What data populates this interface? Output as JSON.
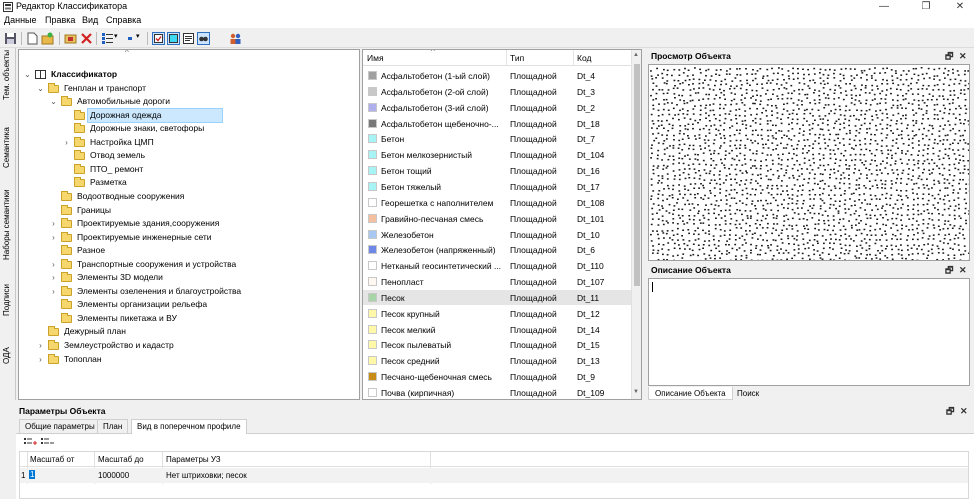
{
  "window": {
    "title": "Редактор Классификатора",
    "accent": "#0078d7"
  },
  "menu": [
    "Данные",
    "Правка",
    "Вид",
    "Справка"
  ],
  "toolbar": {
    "icons": [
      "save-icon",
      "new-icon",
      "new-group-icon",
      "open-folder-icon",
      "delete-icon",
      "list-view-icon",
      "dropdown-icon",
      "small-icon",
      "dropdown-icon",
      "checkbox-icon",
      "color-fill-icon",
      "text-view-icon",
      "find-icon",
      "users-icon"
    ]
  },
  "side_tabs": [
    "Тем. объекты",
    "Семантика",
    "Наборы семантики",
    "Подписи",
    "ОДА"
  ],
  "tree": [
    {
      "label": "Классификатор",
      "level": 0,
      "expand": "v",
      "icon": "book",
      "bold": true
    },
    {
      "label": "Генплан и транспорт",
      "level": 1,
      "expand": "v",
      "icon": "folder"
    },
    {
      "label": "Автомобильные дороги",
      "level": 2,
      "expand": "v",
      "icon": "folder"
    },
    {
      "label": "Дорожная одежда",
      "level": 3,
      "expand": "",
      "icon": "folder",
      "selected": true
    },
    {
      "label": "Дорожные знаки, светофоры",
      "level": 3,
      "expand": "",
      "icon": "folder"
    },
    {
      "label": "Настройка ЦМП",
      "level": 3,
      "expand": ">",
      "icon": "folder"
    },
    {
      "label": "Отвод земель",
      "level": 3,
      "expand": "",
      "icon": "folder"
    },
    {
      "label": "ПТО_ ремонт",
      "level": 3,
      "expand": "",
      "icon": "folder"
    },
    {
      "label": "Разметка",
      "level": 3,
      "expand": "",
      "icon": "folder"
    },
    {
      "label": "Водоотводные сооружения",
      "level": 2,
      "expand": "",
      "icon": "folder"
    },
    {
      "label": "Границы",
      "level": 2,
      "expand": "",
      "icon": "folder"
    },
    {
      "label": "Проектируемые здания,сооружения",
      "level": 2,
      "expand": ">",
      "icon": "folder"
    },
    {
      "label": "Проектируемые инженерные сети",
      "level": 2,
      "expand": ">",
      "icon": "folder"
    },
    {
      "label": "Разное",
      "level": 2,
      "expand": "",
      "icon": "folder"
    },
    {
      "label": "Транспортные сооружения  и устройства",
      "level": 2,
      "expand": ">",
      "icon": "folder"
    },
    {
      "label": "Элементы 3D модели",
      "level": 2,
      "expand": ">",
      "icon": "folder"
    },
    {
      "label": "Элементы озеленения и благоустройства",
      "level": 2,
      "expand": ">",
      "icon": "folder"
    },
    {
      "label": "Элементы организации рельефа",
      "level": 2,
      "expand": "",
      "icon": "folder"
    },
    {
      "label": "Элементы пикетажа и ВУ",
      "level": 2,
      "expand": "",
      "icon": "folder"
    },
    {
      "label": "Дежурный план",
      "level": 1,
      "expand": "",
      "icon": "folder"
    },
    {
      "label": "Землеустройство и кадастр",
      "level": 1,
      "expand": ">",
      "icon": "folder"
    },
    {
      "label": "Топоплан",
      "level": 1,
      "expand": ">",
      "icon": "folder"
    }
  ],
  "list": {
    "columns": [
      "Имя",
      "Тип",
      "Код"
    ],
    "rows": [
      {
        "name": "Асфальтобетон (1-ый слой)",
        "type": "Площадной",
        "code": "Dt_4",
        "color": "#a0a0a0"
      },
      {
        "name": "Асфальтобетон (2-ой слой)",
        "type": "Площадной",
        "code": "Dt_3",
        "color": "#c8c8c8"
      },
      {
        "name": "Асфальтобетон (3-ий слой)",
        "type": "Площадной",
        "code": "Dt_2",
        "color": "#b0b0ee"
      },
      {
        "name": "Асфальтобетон щебеночно-...",
        "type": "Площадной",
        "code": "Dt_18",
        "color": "#787878"
      },
      {
        "name": "Бетон",
        "type": "Площадной",
        "code": "Dt_7",
        "color": "#a8f4f4"
      },
      {
        "name": "Бетон мелкозернистый",
        "type": "Площадной",
        "code": "Dt_104",
        "color": "#a8f4f4"
      },
      {
        "name": "Бетон тощий",
        "type": "Площадной",
        "code": "Dt_16",
        "color": "#a8f4f4"
      },
      {
        "name": "Бетон тяжелый",
        "type": "Площадной",
        "code": "Dt_17",
        "color": "#a8f4f4"
      },
      {
        "name": "Георешетка с наполнителем",
        "type": "Площадной",
        "code": "Dt_108",
        "color": "#ffffff"
      },
      {
        "name": "Гравийно-песчаная смесь",
        "type": "Площадной",
        "code": "Dt_101",
        "color": "#f4c0a0"
      },
      {
        "name": "Железобетон",
        "type": "Площадной",
        "code": "Dt_10",
        "color": "#a8c8f4"
      },
      {
        "name": "Железобетон (напряженный)",
        "type": "Площадной",
        "code": "Dt_6",
        "color": "#6e88e8"
      },
      {
        "name": "Нетканый геосинтетический ...",
        "type": "Площадной",
        "code": "Dt_110",
        "color": "#ffffff"
      },
      {
        "name": "Пенопласт",
        "type": "Площадной",
        "code": "Dt_107",
        "color": "#fff8f0"
      },
      {
        "name": "Песок",
        "type": "Площадной",
        "code": "Dt_11",
        "color": "#a8d4a8",
        "selected": true
      },
      {
        "name": "Песок крупный",
        "type": "Площадной",
        "code": "Dt_12",
        "color": "#fff8a8"
      },
      {
        "name": "Песок мелкий",
        "type": "Площадной",
        "code": "Dt_14",
        "color": "#fff8a8"
      },
      {
        "name": "Песок пылеватый",
        "type": "Площадной",
        "code": "Dt_15",
        "color": "#fff8a8"
      },
      {
        "name": "Песок средний",
        "type": "Площадной",
        "code": "Dt_13",
        "color": "#fff8a8"
      },
      {
        "name": "Песчано-щебеночная смесь",
        "type": "Площадной",
        "code": "Dt_9",
        "color": "#c88c18"
      },
      {
        "name": "Почва (кирпичная)",
        "type": "Площадной",
        "code": "Dt_109",
        "color": "#ffffff"
      }
    ]
  },
  "preview": {
    "title": "Просмотр Объекта"
  },
  "description": {
    "title": "Описание Объекта",
    "value": ""
  },
  "right_tabs": [
    "Описание Объекта",
    "Поиск"
  ],
  "params": {
    "title": "Параметры Объекта",
    "tabs": [
      "Общие параметры",
      "План",
      "Вид в поперечном профиле"
    ],
    "grid": {
      "columns": [
        "Масштаб от",
        "Масштаб до",
        "Параметры УЗ"
      ],
      "rows": [
        {
          "num": "1",
          "from": "1",
          "to": "1000000",
          "params": "Нет штриховки; песок"
        }
      ]
    }
  },
  "panel_buttons": {
    "float": "🗗",
    "close": "✕"
  }
}
